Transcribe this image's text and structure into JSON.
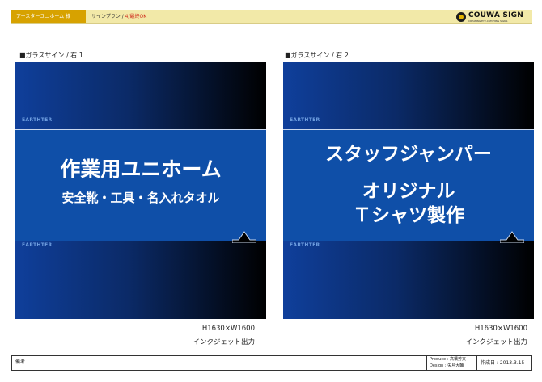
{
  "header": {
    "client": "アースターユニホーム 様",
    "plan_prefix": "サインプラン / ",
    "plan_status": "4/最終OK",
    "logo_text": "COUWA SIGN",
    "logo_sub": "CREATING EYE-CATCHING SIGNS"
  },
  "panels": [
    {
      "label": "■ガラスサイン / 右 1",
      "brand_mark": "EARTHTER",
      "line1": "作業用ユニホーム",
      "line2": "安全靴・工具・名入れタオル",
      "size": "H1630×W1600",
      "method": "インクジェット出力"
    },
    {
      "label": "■ガラスサイン / 右 2",
      "brand_mark": "EARTHTER",
      "line1": "スタッフジャンパー",
      "line2": "オリジナル",
      "line3": "Ｔシャツ製作",
      "size": "H1630×W1600",
      "method": "インクジェット出力"
    }
  ],
  "footer": {
    "remarks": "備考",
    "produce": "Produce : 高橋芳文",
    "design": "Design : 矢島大輔",
    "date": "作成日 : 2013.3.15"
  }
}
